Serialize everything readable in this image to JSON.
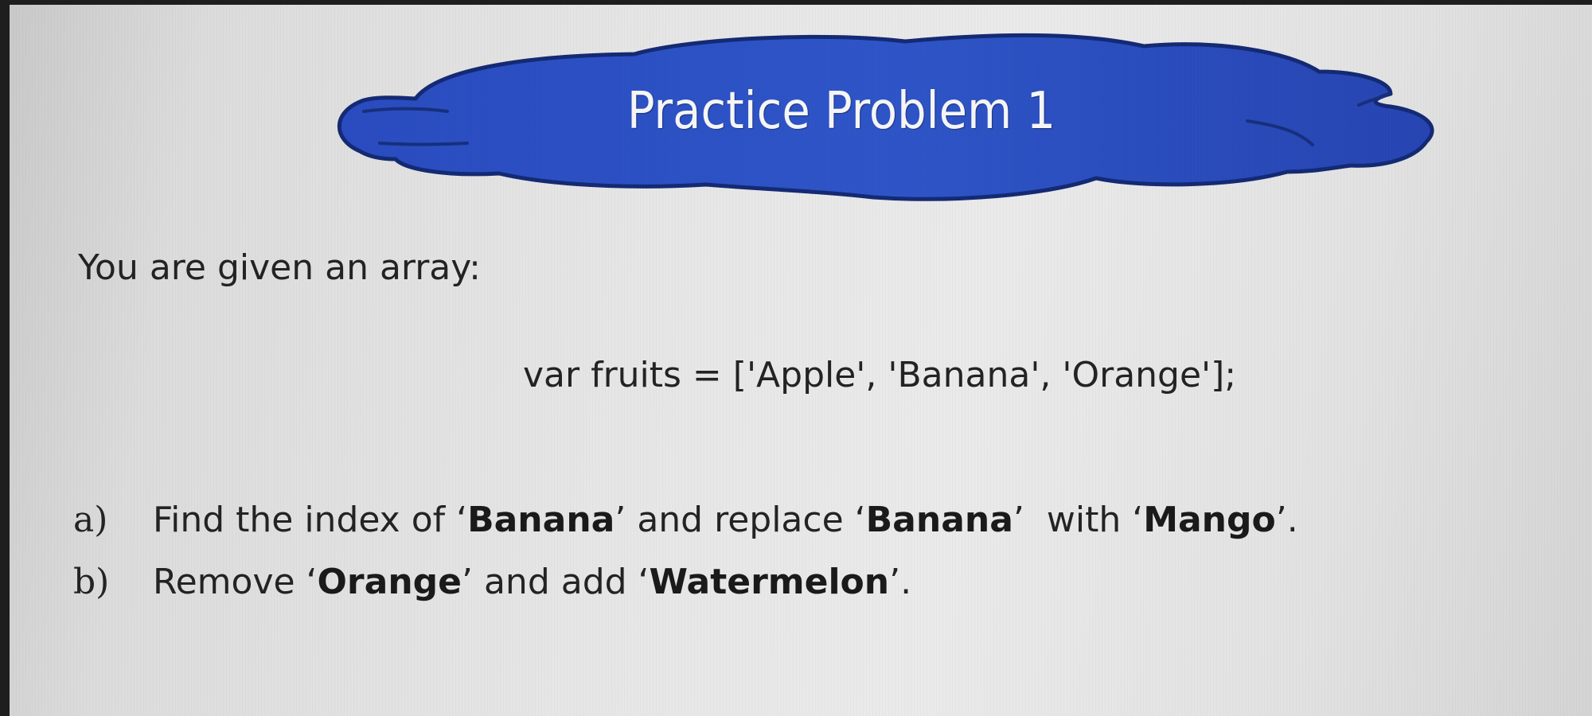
{
  "title": "Practice Problem 1",
  "intro": "You are given an array:",
  "code": "var fruits = ['Apple', 'Banana', 'Orange'];",
  "tasks": [
    {
      "marker": "a)",
      "parts": [
        "Find the index of ‘",
        "Banana",
        "’ and replace ‘",
        "Banana",
        "’  with ‘",
        "Mango",
        "’."
      ]
    },
    {
      "marker": "b)",
      "parts": [
        "Remove ‘",
        "Orange",
        "’ and add ‘",
        "Watermelon",
        "’."
      ]
    }
  ],
  "colors": {
    "cloud_fill": "#2c4fbe",
    "cloud_outline": "#12286e",
    "title_text": "#f5f5f5",
    "body_text": "#232323"
  }
}
